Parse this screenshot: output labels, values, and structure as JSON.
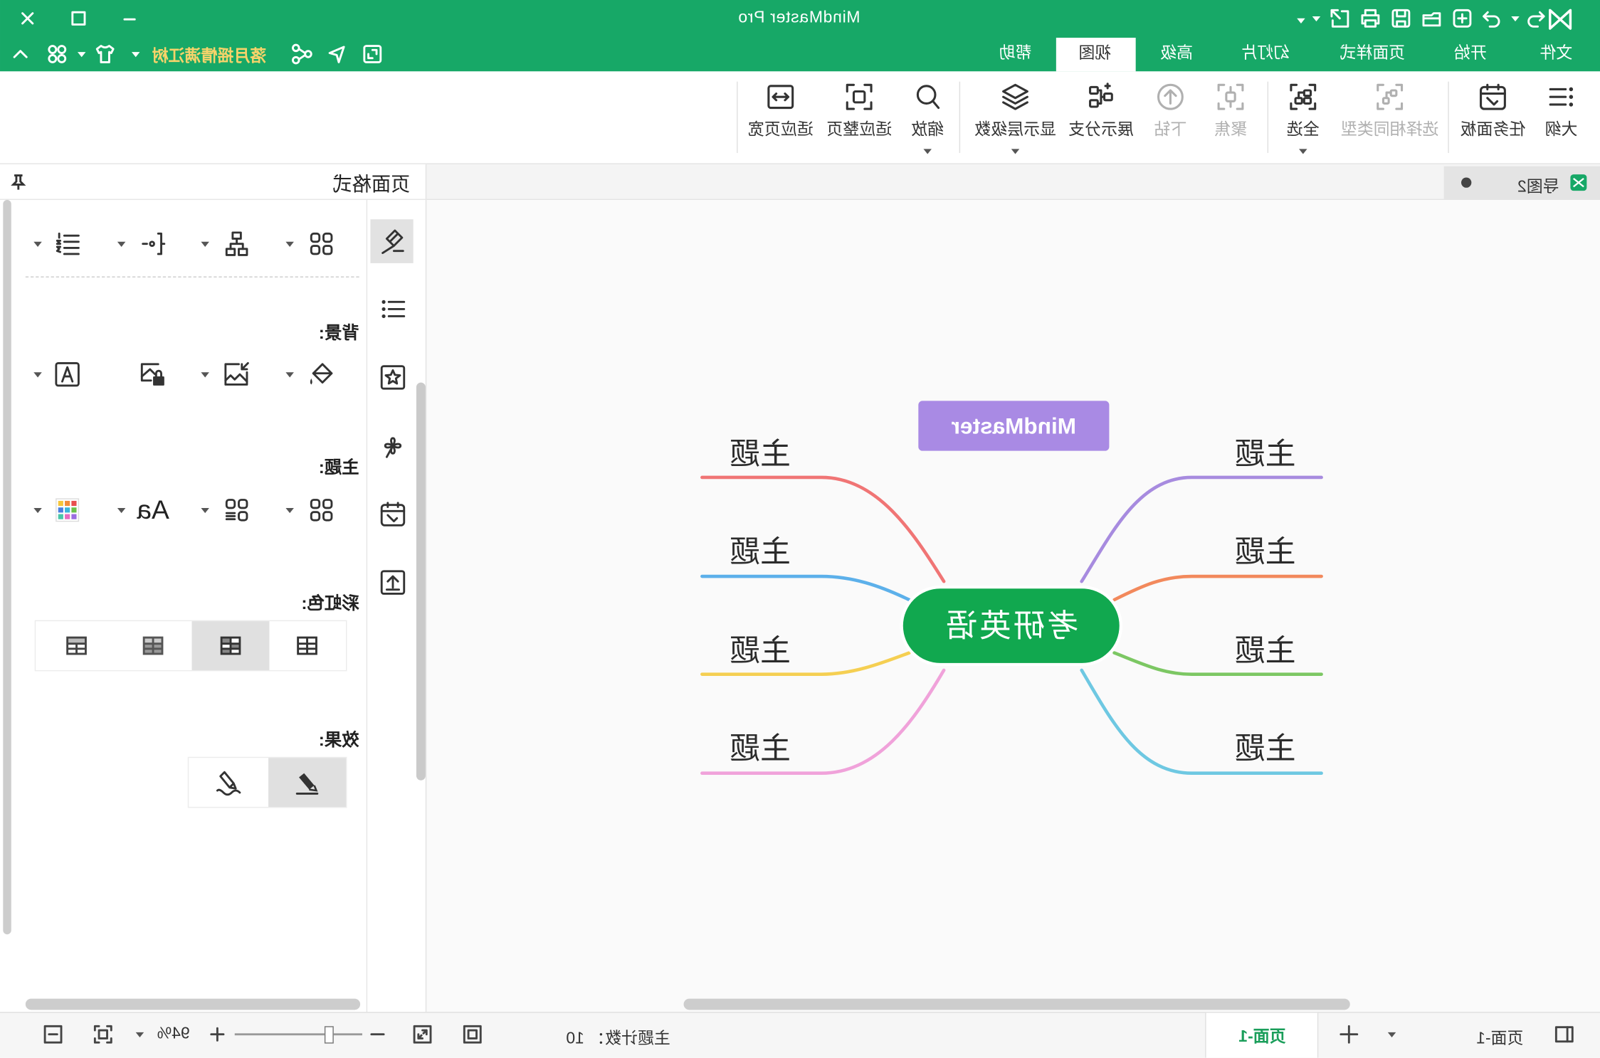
{
  "window": {
    "title": "MindMaster Pro",
    "user": "落月摇情满江树"
  },
  "theme": {
    "brand_green": "#17a867",
    "user_name_yellow": "#f6d36a",
    "central_node_green": "#11a84f",
    "floating_topic_purple": "#a98ae4",
    "active_page_green": "#1a9e5a"
  },
  "menu_tabs": [
    "文件",
    "开始",
    "页面样式",
    "幻灯片",
    "高级",
    "视图",
    "帮助"
  ],
  "ribbon": {
    "outline": "大纲",
    "task_panel": "任务面板",
    "select_same_type": "选择相同类型",
    "select_all": "全选",
    "focus": "聚焦",
    "drill_down": "下钻",
    "show_branch": "展示分支",
    "show_levels": "显示层级数",
    "zoom": "缩放",
    "fit_page": "适应整页",
    "fit_width": "适应页宽"
  },
  "doc_tab": {
    "name": "导图2"
  },
  "panel": {
    "title": "页面格式",
    "background_label": "背景:",
    "theme_label": "主题:",
    "rainbow_label": "彩虹色:",
    "effect_label": "效果:",
    "font_sample": "Aa"
  },
  "mindmap": {
    "central": "考研英语",
    "floating": "MindMaster",
    "branches": [
      {
        "label": "主题",
        "color": "#a78bdf"
      },
      {
        "label": "主题",
        "color": "#f2895c"
      },
      {
        "label": "主题",
        "color": "#7cc763"
      },
      {
        "label": "主题",
        "color": "#6ec8e2"
      },
      {
        "label": "主题",
        "color": "#f07575"
      },
      {
        "label": "主题",
        "color": "#5cb0ea"
      },
      {
        "label": "主题",
        "color": "#f5cf52"
      },
      {
        "label": "主题",
        "color": "#f0a2da"
      }
    ]
  },
  "status": {
    "page_selector": "页面-1",
    "page_tab": "页面-1",
    "topic_count_label": "主题计数：",
    "topic_count": "10",
    "zoom": "94%"
  },
  "icons": {
    "title_bar": [
      "app-logo-icon",
      "undo-icon",
      "redo-icon",
      "new-file-icon",
      "open-icon",
      "save-icon",
      "print-icon",
      "export-icon",
      "minimize-icon",
      "maximize-icon",
      "close-icon"
    ],
    "ribbon": [
      "outline-icon",
      "task-panel-icon",
      "select-same-type-icon",
      "select-all-icon",
      "focus-icon",
      "drill-down-icon",
      "show-branch-icon",
      "layers-icon",
      "zoom-icon",
      "fit-page-icon",
      "fit-width-icon"
    ],
    "side_tabs": [
      "page-format-icon",
      "outline-list-icon",
      "clipart-icon",
      "clover-icon",
      "task-icon",
      "upload-icon"
    ]
  }
}
